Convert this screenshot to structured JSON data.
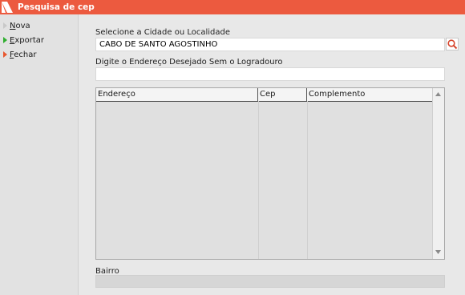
{
  "window": {
    "title": "Pesquisa de cep"
  },
  "menu": [
    {
      "label": "Nova",
      "color": "#c9c9c9"
    },
    {
      "label": "Exportar",
      "color": "#2fae2f"
    },
    {
      "label": "Fechar",
      "color": "#e8572f"
    }
  ],
  "city": {
    "label": "Selecione a Cidade ou Localidade",
    "value": "CABO DE SANTO AGOSTINHO"
  },
  "address": {
    "label": "Digite o Endereço Desejado Sem o Logradouro",
    "value": ""
  },
  "grid": {
    "columns": [
      "Endereço",
      "Cep",
      "Complemento"
    ]
  },
  "bairro": {
    "label": "Bairro",
    "value": ""
  },
  "colors": {
    "accent": "#ec5a3f"
  }
}
